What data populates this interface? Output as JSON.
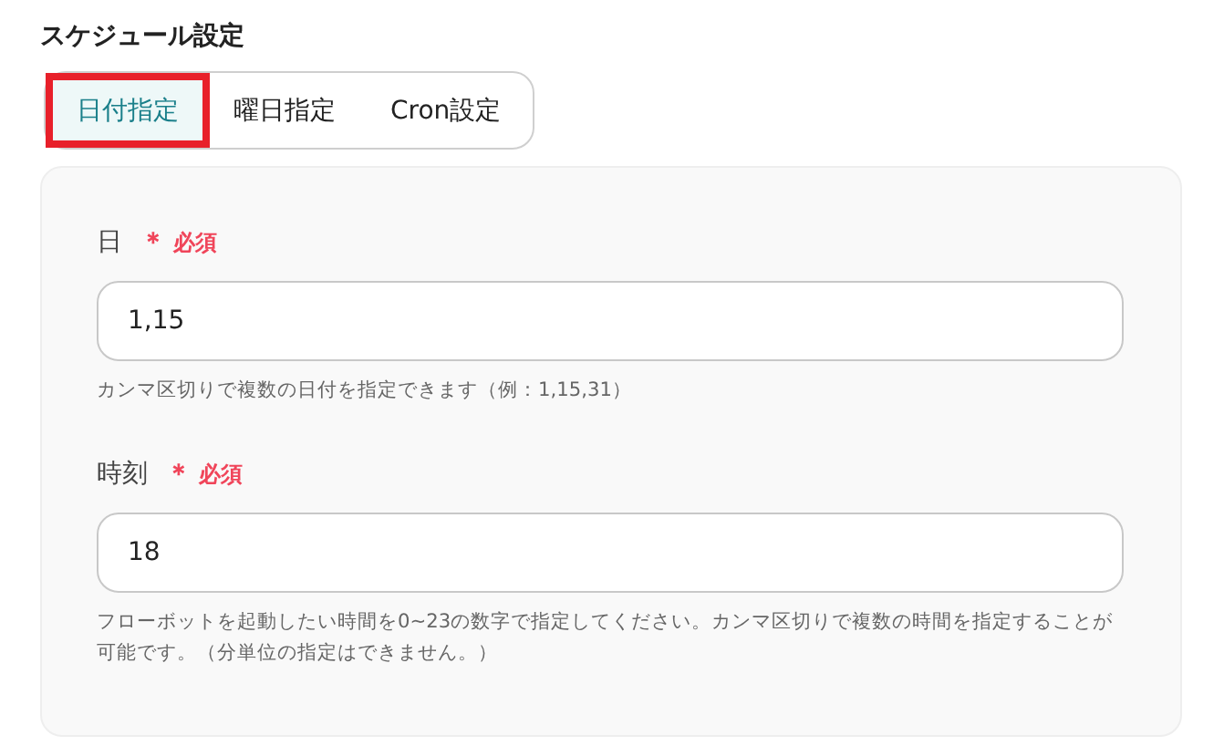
{
  "title": "スケジュール設定",
  "tabs": [
    {
      "label": "日付指定",
      "selected": true,
      "highlighted": true
    },
    {
      "label": "曜日指定",
      "selected": false,
      "highlighted": false
    },
    {
      "label": "Cron設定",
      "selected": false,
      "highlighted": false
    }
  ],
  "fields": [
    {
      "label": "日",
      "required_mark": "＊",
      "required": "必須",
      "value": "1,15",
      "hint": "カンマ区切りで複数の日付を指定できます（例：1,15,31）"
    },
    {
      "label": "時刻",
      "required_mark": "＊",
      "required": "必須",
      "value": "18",
      "hint": "フローボットを起動したい時間を0~23の数字で指定してください。カンマ区切りで複数の時間を指定することが可能です。（分単位の指定はできません。）"
    }
  ]
}
